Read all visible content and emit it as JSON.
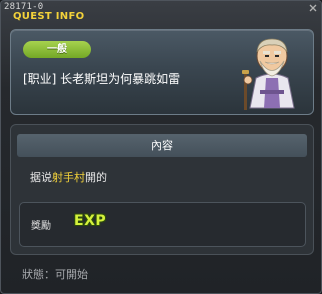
{
  "window": {
    "quest_id": "28171-0",
    "title": "QUEST INFO"
  },
  "header": {
    "category": "一般",
    "quest_name": "[职业] 长老斯坦为何暴跳如雷",
    "npc": "elder-stan-npc"
  },
  "content": {
    "heading": "內容",
    "text_before": "据说",
    "text_highlight": "射手村",
    "text_after": "開的"
  },
  "reward": {
    "label": "獎勵",
    "exp_label": "EXP"
  },
  "status": {
    "text": "狀態：可開始"
  },
  "colors": {
    "title": "#f3d23a",
    "highlight": "#f3d23a",
    "category_pill": "#8cc13a",
    "exp": "#d5f23c"
  }
}
